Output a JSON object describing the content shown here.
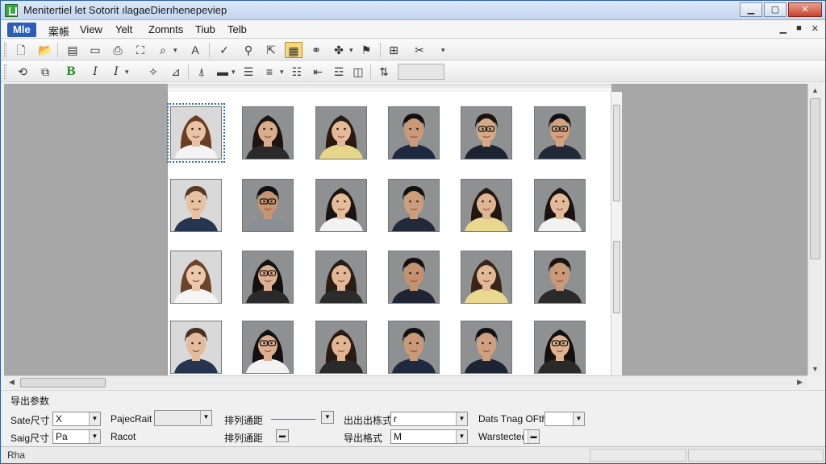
{
  "window": {
    "title": "Menitertiel let Sotorit ılagaeDierıhenepeviep"
  },
  "menu": {
    "items": [
      {
        "label": "Mle",
        "active": true
      },
      {
        "label": "案帳",
        "active": false
      },
      {
        "label": "View",
        "active": false
      },
      {
        "label": "Yelt",
        "active": false
      },
      {
        "label": "Zomnts",
        "active": false
      },
      {
        "label": "Tiub",
        "active": false
      },
      {
        "label": "Telb",
        "active": false
      }
    ],
    "mdi": {
      "minimize": "▁",
      "restore": "■",
      "close": "✕"
    }
  },
  "toolbar2": {
    "bold": "B",
    "italic": "I",
    "italic2": "I"
  },
  "icons": {
    "new": "new-document-icon",
    "open": "open-folder-icon",
    "save": "save-icon",
    "print": "print-icon",
    "crop": "crop-icon",
    "zoom": "zoom-icon",
    "text": "text-icon",
    "check": "check-icon",
    "search": "search-icon",
    "select": "select-icon"
  },
  "photos": [
    {
      "row": 0,
      "col": 0,
      "gender": "f",
      "hair": "#6b3e24",
      "skin": "#e8c3a6",
      "glasses": false,
      "shirt": "#f3f3f3",
      "selected": true
    },
    {
      "row": 0,
      "col": 1,
      "gender": "f",
      "hair": "#1c1410",
      "skin": "#d9ad8c",
      "glasses": false,
      "shirt": "#2a2a2a",
      "selected": false
    },
    {
      "row": 0,
      "col": 2,
      "gender": "f",
      "hair": "#2a1a12",
      "skin": "#e3b997",
      "glasses": false,
      "shirt": "#e6d68a",
      "selected": false
    },
    {
      "row": 0,
      "col": 3,
      "gender": "m",
      "hair": "#141010",
      "skin": "#c99a78",
      "glasses": false,
      "shirt": "#1e2a40",
      "selected": false
    },
    {
      "row": 0,
      "col": 4,
      "gender": "m",
      "hair": "#181210",
      "skin": "#d6a884",
      "glasses": true,
      "shirt": "#1c2333",
      "selected": false
    },
    {
      "row": 0,
      "col": 5,
      "gender": "m",
      "hair": "#111",
      "skin": "#d2a27f",
      "glasses": true,
      "shirt": "#222a3a",
      "selected": false
    },
    {
      "row": 1,
      "col": 0,
      "gender": "m",
      "hair": "#5a3a24",
      "skin": "#e6c2a2",
      "glasses": false,
      "shirt": "#26354f",
      "selected": false
    },
    {
      "row": 1,
      "col": 1,
      "gender": "m",
      "hair": "#141010",
      "skin": "#c69470",
      "glasses": true,
      "shirt": "#8a8f95",
      "selected": false
    },
    {
      "row": 1,
      "col": 2,
      "gender": "f",
      "hair": "#1c1410",
      "skin": "#e4bc9a",
      "glasses": false,
      "shirt": "#f2f2f2",
      "selected": false
    },
    {
      "row": 1,
      "col": 3,
      "gender": "m",
      "hair": "#151111",
      "skin": "#cd9e7c",
      "glasses": false,
      "shirt": "#222a3a",
      "selected": false
    },
    {
      "row": 1,
      "col": 4,
      "gender": "f",
      "hair": "#22160f",
      "skin": "#deb492",
      "glasses": false,
      "shirt": "#e8d88f",
      "selected": false
    },
    {
      "row": 1,
      "col": 5,
      "gender": "f",
      "hair": "#1a1210",
      "skin": "#e3bb9b",
      "glasses": false,
      "shirt": "#f2f2f2",
      "selected": false
    },
    {
      "row": 2,
      "col": 0,
      "gender": "f",
      "hair": "#6c442a",
      "skin": "#ebc8aa",
      "glasses": false,
      "shirt": "#f5f5f5",
      "selected": false
    },
    {
      "row": 2,
      "col": 1,
      "gender": "f",
      "hair": "#131010",
      "skin": "#dcb090",
      "glasses": true,
      "shirt": "#2a2a2a",
      "selected": false
    },
    {
      "row": 2,
      "col": 2,
      "gender": "f",
      "hair": "#2a1b13",
      "skin": "#e1b795",
      "glasses": false,
      "shirt": "#2b2b2b",
      "selected": false
    },
    {
      "row": 2,
      "col": 3,
      "gender": "m",
      "hair": "#141010",
      "skin": "#c4926f",
      "glasses": false,
      "shirt": "#1f2533",
      "selected": false
    },
    {
      "row": 2,
      "col": 4,
      "gender": "f",
      "hair": "#3a2518",
      "skin": "#e2b996",
      "glasses": false,
      "shirt": "#e8d890",
      "selected": false
    },
    {
      "row": 2,
      "col": 5,
      "gender": "m",
      "hair": "#1a1410",
      "skin": "#c89a78",
      "glasses": false,
      "shirt": "#2a2a2a",
      "selected": false
    },
    {
      "row": 3,
      "col": 0,
      "gender": "m",
      "hair": "#4a3020",
      "skin": "#e2bc9c",
      "glasses": false,
      "shirt": "#26354f",
      "selected": false
    },
    {
      "row": 3,
      "col": 1,
      "gender": "f",
      "hair": "#141010",
      "skin": "#dcb090",
      "glasses": true,
      "shirt": "#f2f2f2",
      "selected": false
    },
    {
      "row": 3,
      "col": 2,
      "gender": "f",
      "hair": "#2a1a12",
      "skin": "#e0b694",
      "glasses": false,
      "shirt": "#2a2a2a",
      "selected": false
    },
    {
      "row": 3,
      "col": 3,
      "gender": "m",
      "hair": "#141010",
      "skin": "#c99a78",
      "glasses": false,
      "shirt": "#1e2a40",
      "selected": false
    },
    {
      "row": 3,
      "col": 4,
      "gender": "m",
      "hair": "#151111",
      "skin": "#d0a07e",
      "glasses": false,
      "shirt": "#1c2333",
      "selected": false
    },
    {
      "row": 3,
      "col": 5,
      "gender": "f",
      "hair": "#141010",
      "skin": "#deb290",
      "glasses": true,
      "shirt": "#2a2a2a",
      "selected": false
    }
  ],
  "panel": {
    "title": "导出参数",
    "row1": {
      "label1": "Sate尺寸",
      "field1": "X",
      "label2": "PajecRait",
      "label3": "排列通距",
      "label4": "出出出栋式",
      "field4": "r",
      "label5": "Dats Tnag OFth"
    },
    "row2": {
      "label1": "Saig尺寸",
      "field1": "Pa",
      "label2": "Racot",
      "label3": "排列通距",
      "label4": "导出格式",
      "field4": "M",
      "label5": "Warstected"
    }
  },
  "status": {
    "text": "Rha"
  }
}
